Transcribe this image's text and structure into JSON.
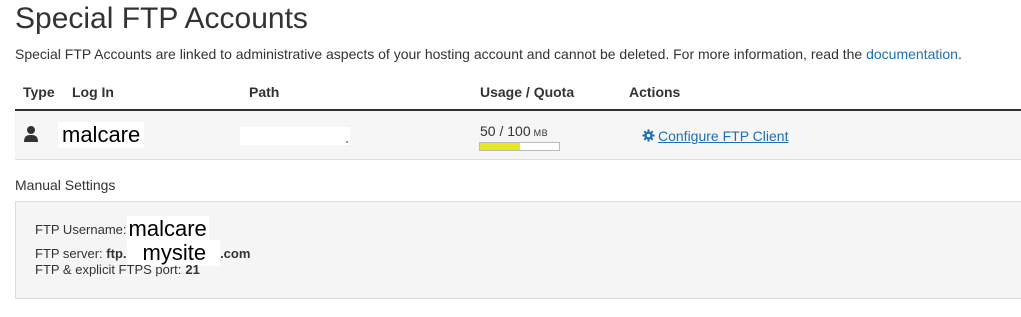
{
  "page": {
    "title": "Special FTP Accounts",
    "description": "Special FTP Accounts are linked to administrative aspects of your hosting account and cannot be deleted. For more information, read the ",
    "doc_link": "documentation",
    "description_end": "."
  },
  "table": {
    "headers": {
      "type": "Type",
      "login": "Log In",
      "path": "Path",
      "usage": "Usage / Quota",
      "actions": "Actions"
    },
    "row": {
      "type_icon": "user-icon",
      "login": "malcare",
      "usage": "50 / 100",
      "usage_unit": "MB",
      "usage_fraction": 0.5,
      "action_label": "Configure FTP Client",
      "action_icon": "gear-icon"
    }
  },
  "manual": {
    "heading": "Manual Settings",
    "username_label": "FTP Username:",
    "username_value": "malcare",
    "server_label": "FTP server: ",
    "server_prefix": "ftp.",
    "server_mid": "mysite",
    "server_suffix": ".com",
    "port_label": "FTP & explicit FTPS port:",
    "port_value": "21"
  },
  "colors": {
    "link": "#1f6fb2",
    "usage_fill": "#e8e81c"
  }
}
